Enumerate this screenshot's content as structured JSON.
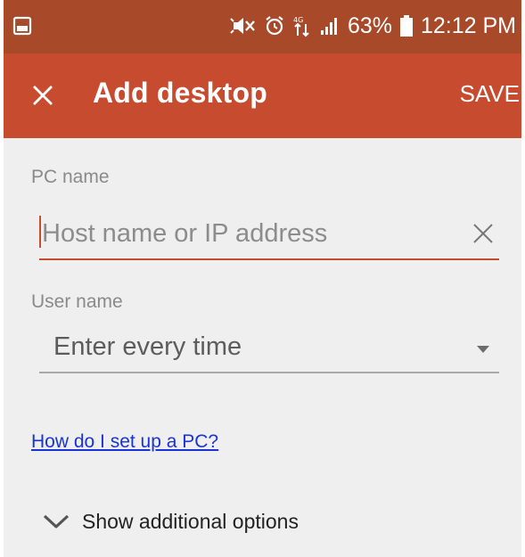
{
  "status_bar": {
    "battery_percent": "63%",
    "time": "12:12 PM",
    "icons": [
      "gallery-icon",
      "mute-icon",
      "alarm-icon",
      "data-arrows-icon",
      "signal-icon",
      "battery-icon"
    ]
  },
  "app_bar": {
    "title": "Add desktop",
    "save_label": "SAVE",
    "close_icon": "close-icon"
  },
  "form": {
    "pc_name_label": "PC name",
    "pc_name_placeholder": "Host name or IP address",
    "pc_name_value": "",
    "user_name_label": "User name",
    "user_name_value": "Enter every time",
    "help_link": "How do I set up a PC?",
    "more_options_label": "Show additional options"
  },
  "colors": {
    "status_bar": "#a84a2a",
    "app_bar": "#c74b2e",
    "accent": "#c74b2e",
    "link": "#1a33d6",
    "background": "#efefef"
  }
}
